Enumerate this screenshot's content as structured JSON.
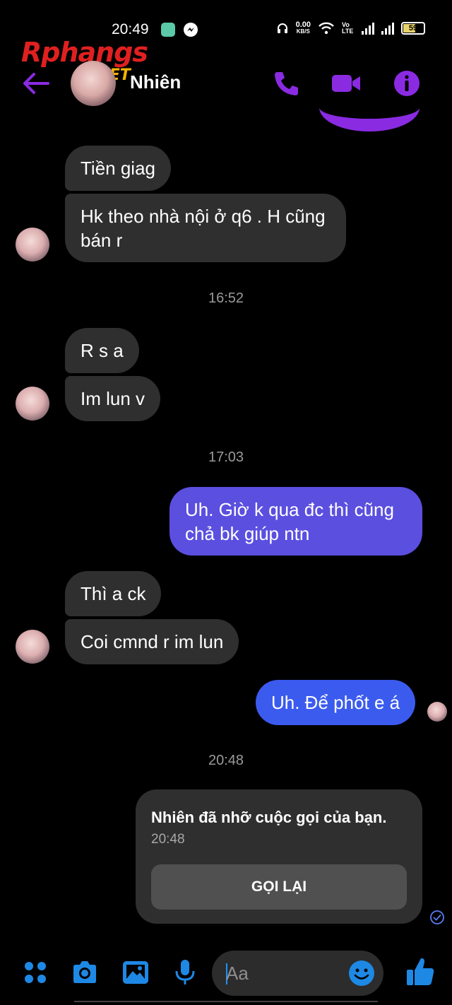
{
  "status_bar": {
    "time": "20:49",
    "net_speed_value": "0.00",
    "net_speed_unit": "KB/S",
    "volte_label": "Vo LTE",
    "battery": "59"
  },
  "watermark": {
    "brand": "Rphangs",
    "suffix": ".NET"
  },
  "header": {
    "contact_name": "Nhiên"
  },
  "messages": [
    {
      "id": "m1",
      "direction": "incoming",
      "text": "Tiền giag"
    },
    {
      "id": "m2",
      "direction": "incoming",
      "lines": [
        "Hk theo nhà nội ở q6 . H cũng",
        "bán r"
      ]
    },
    {
      "id": "t1",
      "timestamp": "16:52"
    },
    {
      "id": "m3",
      "direction": "incoming",
      "text": "R s a"
    },
    {
      "id": "m4",
      "direction": "incoming",
      "text": "Im lun v"
    },
    {
      "id": "t2",
      "timestamp": "17:03"
    },
    {
      "id": "m5",
      "direction": "outgoing",
      "lines": [
        "Uh. Giờ k qua đc thì cũng",
        "chả bk giúp ntn"
      ]
    },
    {
      "id": "m6",
      "direction": "incoming",
      "text": "Thì a ck"
    },
    {
      "id": "m7",
      "direction": "incoming",
      "text": "Coi cmnd r im lun"
    },
    {
      "id": "m8",
      "direction": "outgoing",
      "text": "Uh. Để phốt e á"
    },
    {
      "id": "t3",
      "timestamp": "20:48"
    }
  ],
  "missed_call": {
    "title": "Nhiên đã nhỡ cuộc gọi của bạn.",
    "time": "20:48",
    "button_label": "GỌI LẠI"
  },
  "composer": {
    "placeholder": "Aa"
  },
  "colors": {
    "accent": "#8a2be2",
    "outgoing_bubble": "#5b4fe0",
    "outgoing_bubble_alt": "#3b5bef",
    "incoming_bubble": "#2f2f2f",
    "composer_icon": "#1e88e5"
  },
  "icons": [
    "back-arrow-icon",
    "phone-icon",
    "video-camera-icon",
    "info-icon",
    "menu-dots-icon",
    "camera-icon",
    "gallery-icon",
    "microphone-icon",
    "emoji-icon",
    "thumbs-up-icon"
  ]
}
